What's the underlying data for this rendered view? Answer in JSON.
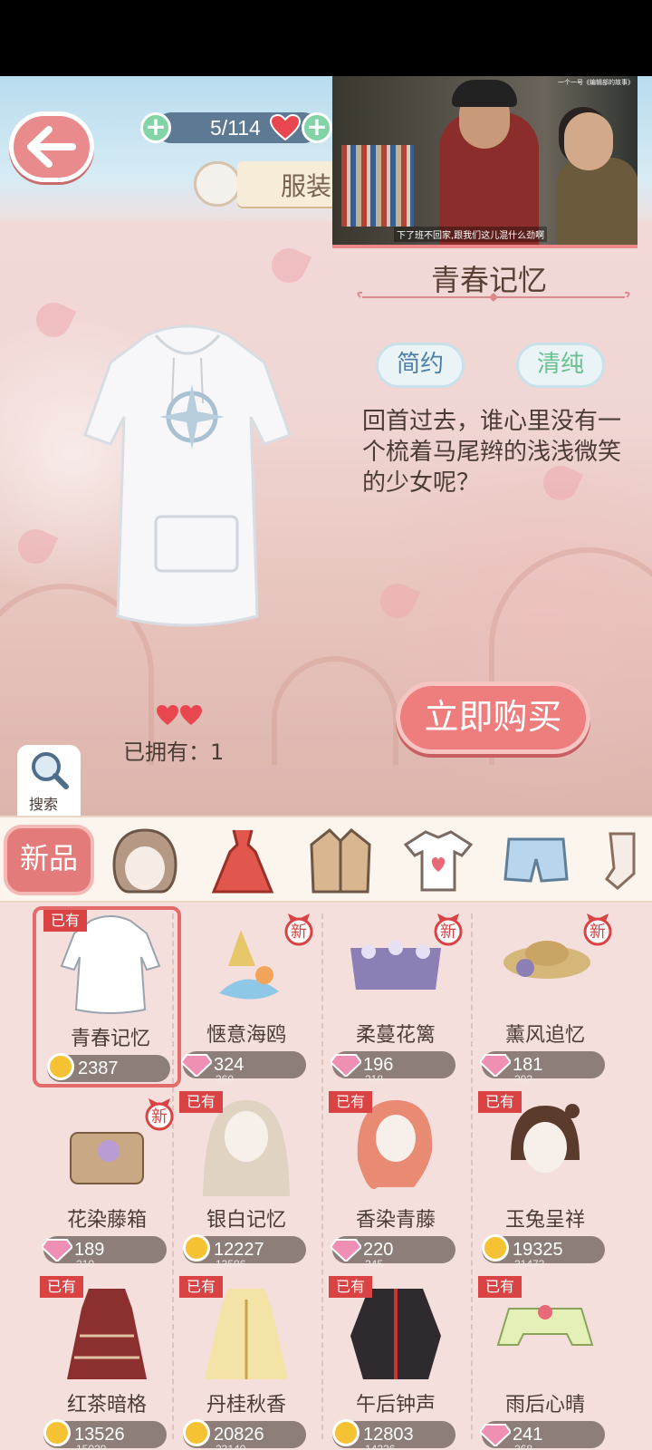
{
  "header": {
    "stamina": "5/114",
    "costume_tab": "服装"
  },
  "video": {
    "caption": "下了班不回家,跟我们这儿混什么劲啊",
    "credit": "一个一号《编辑部的故事》"
  },
  "item": {
    "title": "青春记忆",
    "tags": [
      "简约",
      "清纯"
    ],
    "description": "回首过去，谁心里没有一个梳着马尾辫的浅浅微笑的少女呢？",
    "owned_label": "已拥有：1",
    "buy_label": "立即购买"
  },
  "search": {
    "label": "搜索"
  },
  "categories": {
    "new_label": "新品",
    "icons": [
      "hair-icon",
      "dress-icon",
      "coat-icon",
      "tshirt-icon",
      "shorts-icon",
      "socks-icon"
    ]
  },
  "badges": {
    "owned": "已有",
    "new": "新"
  },
  "items": [
    {
      "name": "青春记忆",
      "price": "2387",
      "orig": "",
      "currency": "coin",
      "owned": true,
      "new": false,
      "selected": true
    },
    {
      "name": "惬意海鸥",
      "price": "324",
      "orig": "360",
      "currency": "gem",
      "owned": false,
      "new": true,
      "selected": false
    },
    {
      "name": "柔蔓花篱",
      "price": "196",
      "orig": "218",
      "currency": "gem",
      "owned": false,
      "new": true,
      "selected": false
    },
    {
      "name": "薰风追忆",
      "price": "181",
      "orig": "202",
      "currency": "gem",
      "owned": false,
      "new": true,
      "selected": false
    },
    {
      "name": "花染藤箱",
      "price": "189",
      "orig": "210",
      "currency": "gem",
      "owned": false,
      "new": true,
      "selected": false
    },
    {
      "name": "银白记忆",
      "price": "12227",
      "orig": "13586",
      "currency": "coin",
      "owned": true,
      "new": false,
      "selected": false
    },
    {
      "name": "香染青藤",
      "price": "220",
      "orig": "245",
      "currency": "gem",
      "owned": true,
      "new": false,
      "selected": false
    },
    {
      "name": "玉兔呈祥",
      "price": "19325",
      "orig": "21473",
      "currency": "coin",
      "owned": true,
      "new": false,
      "selected": false
    },
    {
      "name": "红茶暗格",
      "price": "13526",
      "orig": "15029",
      "currency": "coin",
      "owned": true,
      "new": false,
      "selected": false
    },
    {
      "name": "丹桂秋香",
      "price": "20826",
      "orig": "23140",
      "currency": "coin",
      "owned": true,
      "new": false,
      "selected": false
    },
    {
      "name": "午后钟声",
      "price": "12803",
      "orig": "14226",
      "currency": "coin",
      "owned": true,
      "new": false,
      "selected": false
    },
    {
      "name": "雨后心晴",
      "price": "241",
      "orig": "268",
      "currency": "gem",
      "owned": true,
      "new": false,
      "selected": false
    }
  ],
  "colors": {
    "accent": "#e98a8c",
    "owned_badge": "#d94343",
    "tag_simple": "#4d7fa7",
    "tag_pure": "#6cbf8e",
    "coin": "#f4c233"
  }
}
